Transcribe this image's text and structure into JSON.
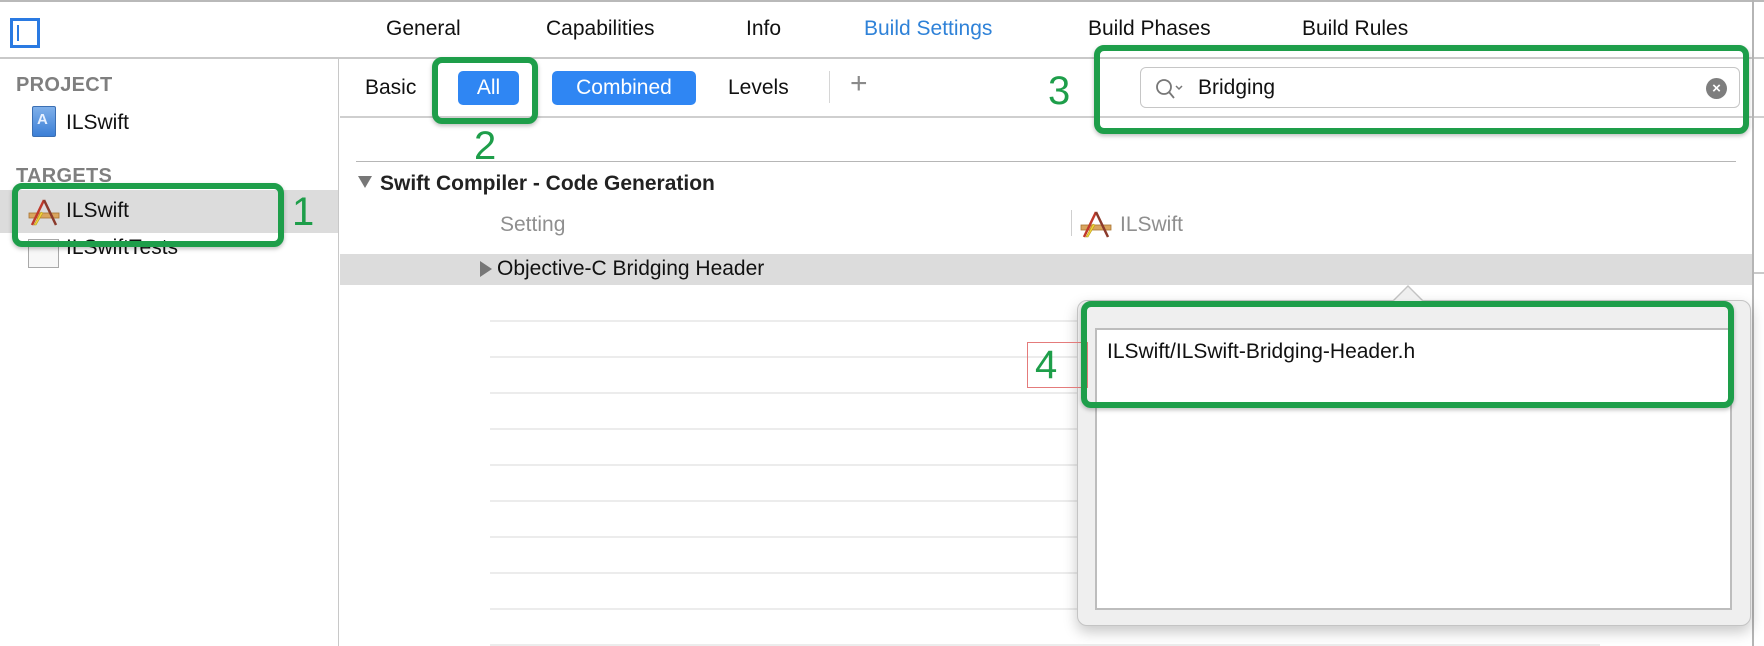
{
  "topbar": {
    "tabs": [
      {
        "label": "General",
        "active": false
      },
      {
        "label": "Capabilities",
        "active": false
      },
      {
        "label": "Info",
        "active": false
      },
      {
        "label": "Build Settings",
        "active": true
      },
      {
        "label": "Build Phases",
        "active": false
      },
      {
        "label": "Build Rules",
        "active": false
      }
    ],
    "sidebar_toggle_icon": "sidebar-toggle-icon"
  },
  "sidebar": {
    "project_header": "PROJECT",
    "project_items": [
      {
        "label": "ILSwift",
        "icon": "project-file-icon"
      }
    ],
    "targets_header": "TARGETS",
    "target_items": [
      {
        "label": "ILSwift",
        "icon": "app-target-icon",
        "selected": true
      },
      {
        "label": "ILSwiftTests",
        "icon": "test-bundle-icon",
        "selected": false
      }
    ]
  },
  "filterbar": {
    "basic_label": "Basic",
    "all_label": "All",
    "combined_label": "Combined",
    "levels_label": "Levels",
    "add_label": "+",
    "search": {
      "value": "Bridging",
      "placeholder": "",
      "icon": "search-icon",
      "clear_icon": "clear-icon"
    }
  },
  "content": {
    "section_title": "Swift Compiler - Code Generation",
    "columns": {
      "setting": "Setting",
      "target": "ILSwift"
    },
    "rows": [
      {
        "label": "Objective-C Bridging Header"
      }
    ]
  },
  "popover": {
    "value": "ILSwift/ILSwift-Bridging-Header.h"
  },
  "annotations": {
    "labels": [
      "1",
      "2",
      "3",
      "4"
    ],
    "accent_color": "#1e9e4a"
  },
  "colors": {
    "accent_blue": "#2f86f3",
    "active_tab": "#2f82d8",
    "selection_gray": "#dcdcdc"
  }
}
